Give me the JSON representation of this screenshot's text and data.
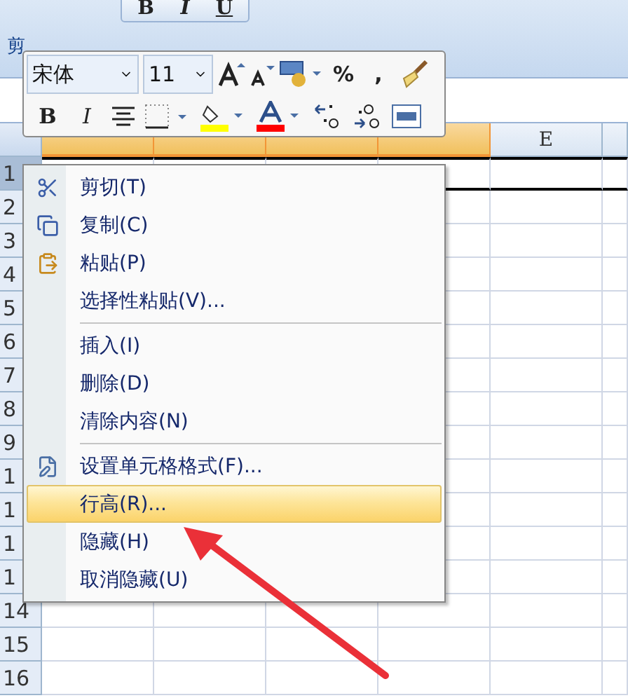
{
  "ribbon": {
    "group_label": "剪",
    "format_buttons": [
      {
        "label": "B"
      },
      {
        "label": "I"
      },
      {
        "label": "U"
      }
    ]
  },
  "mini_toolbar": {
    "font": "宋体",
    "size": "11",
    "row1_buttons": [
      {
        "kind": "grow-font"
      },
      {
        "kind": "shrink-font"
      },
      {
        "kind": "currency"
      },
      {
        "kind": "text",
        "label": "%"
      },
      {
        "kind": "text",
        "label": ","
      },
      {
        "kind": "brush"
      }
    ],
    "row2_buttons": [
      {
        "kind": "bold",
        "label": "B"
      },
      {
        "kind": "italic",
        "label": "I"
      },
      {
        "kind": "center"
      },
      {
        "kind": "border"
      },
      {
        "kind": "fill"
      },
      {
        "kind": "font-color"
      },
      {
        "kind": "inc-decimal"
      },
      {
        "kind": "dec-decimal"
      },
      {
        "kind": "merge"
      }
    ]
  },
  "sheet": {
    "columns": [
      {
        "highlighted": true
      },
      {
        "highlighted": true
      },
      {
        "highlighted": true
      },
      {
        "highlighted": true
      },
      {
        "label": "E",
        "highlighted": false
      }
    ],
    "rows": [
      {
        "label": "1",
        "selected": true
      },
      {
        "label": "2",
        "selected": false
      },
      {
        "label": "3",
        "selected": false
      },
      {
        "label": "4",
        "selected": false
      },
      {
        "label": "5",
        "selected": false
      },
      {
        "label": "6",
        "selected": false
      },
      {
        "label": "7",
        "selected": false
      },
      {
        "label": "8",
        "selected": false
      },
      {
        "label": "9",
        "selected": false
      },
      {
        "label": "1",
        "selected": false
      },
      {
        "label": "1",
        "selected": false
      },
      {
        "label": "1",
        "selected": false
      },
      {
        "label": "1",
        "selected": false
      },
      {
        "label": "14",
        "selected": false
      },
      {
        "label": "15",
        "selected": false
      },
      {
        "label": "16",
        "selected": false
      }
    ]
  },
  "context_menu": {
    "items": [
      {
        "kind": "cut",
        "label": "剪切(T)",
        "selected": false
      },
      {
        "kind": "copy",
        "label": "复制(C)",
        "selected": false
      },
      {
        "kind": "paste",
        "label": "粘贴(P)",
        "selected": false
      },
      {
        "kind": "plain",
        "label": "选择性粘贴(V)...",
        "selected": false
      },
      {
        "kind": "separator"
      },
      {
        "kind": "plain",
        "label": "插入(I)",
        "selected": false
      },
      {
        "kind": "plain",
        "label": "删除(D)",
        "selected": false
      },
      {
        "kind": "plain",
        "label": "清除内容(N)",
        "selected": false
      },
      {
        "kind": "separator"
      },
      {
        "kind": "format",
        "label": "设置单元格格式(F)...",
        "selected": false
      },
      {
        "kind": "plain",
        "label": "行高(R)...",
        "selected": true
      },
      {
        "kind": "plain",
        "label": "隐藏(H)",
        "selected": false
      },
      {
        "kind": "plain",
        "label": "取消隐藏(U)",
        "selected": false
      }
    ]
  },
  "annotation": {
    "kind": "arrow"
  }
}
